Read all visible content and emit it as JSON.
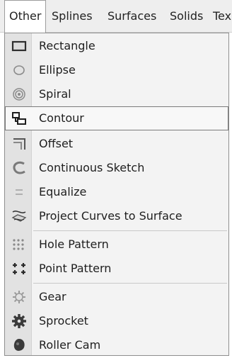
{
  "menubar": {
    "items": [
      "Other",
      "Splines",
      "Surfaces",
      "Solids",
      "Tex"
    ]
  },
  "menu": {
    "items": [
      {
        "label": "Rectangle",
        "icon": "rectangle-icon"
      },
      {
        "label": "Ellipse",
        "icon": "ellipse-icon"
      },
      {
        "label": "Spiral",
        "icon": "spiral-icon"
      },
      {
        "label": "Contour",
        "icon": "contour-icon",
        "highlighted": true
      },
      {
        "label": "Offset",
        "icon": "offset-icon"
      },
      {
        "label": "Continuous Sketch",
        "icon": "continuous-sketch-icon"
      },
      {
        "label": "Equalize",
        "icon": "equalize-icon"
      },
      {
        "label": "Project Curves to Surface",
        "icon": "project-curves-icon"
      },
      {
        "label": "Hole Pattern",
        "icon": "hole-pattern-icon"
      },
      {
        "label": "Point Pattern",
        "icon": "point-pattern-icon"
      },
      {
        "label": "Gear",
        "icon": "gear-icon"
      },
      {
        "label": "Sprocket",
        "icon": "sprocket-icon"
      },
      {
        "label": "Roller Cam",
        "icon": "roller-cam-icon"
      }
    ]
  }
}
